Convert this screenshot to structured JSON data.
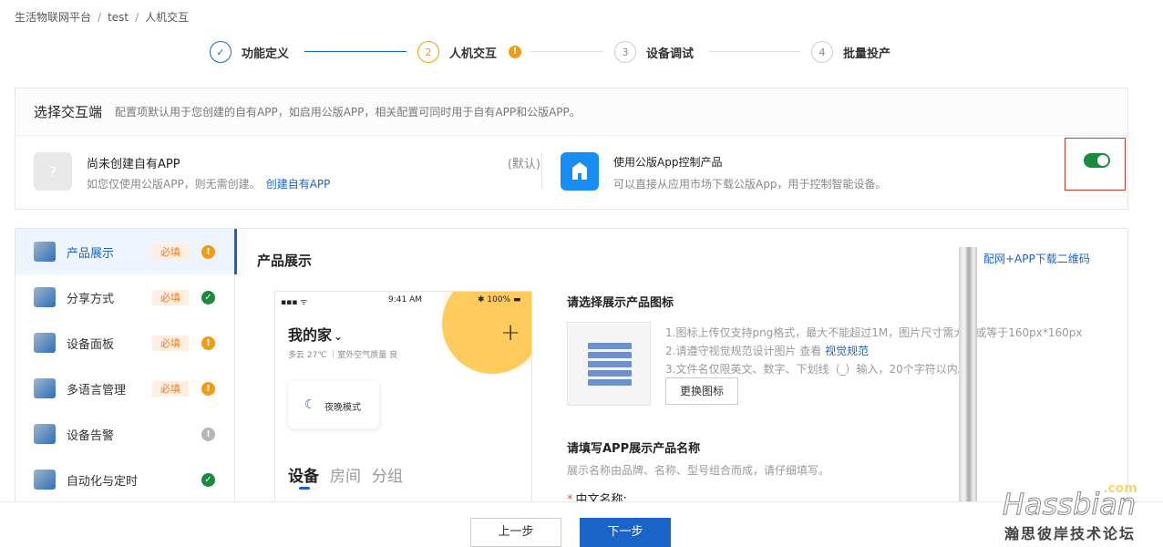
{
  "breadcrumb": [
    "生活物联网平台",
    "test",
    "人机交互"
  ],
  "steps": [
    {
      "num": "✓",
      "label": "功能定义"
    },
    {
      "num": "2",
      "label": "人机交互",
      "warn": "!"
    },
    {
      "num": "3",
      "label": "设备调试"
    },
    {
      "num": "4",
      "label": "批量投产"
    }
  ],
  "interact": {
    "title": "选择交互端",
    "desc": "配置项默认用于您创建的自有APP，如启用公版APP，相关配置可同时用于自有APP和公版APP。",
    "own_app": {
      "icon": "?",
      "name": "尚未创建自有APP",
      "default": "(默认)",
      "desc": "如您仅使用公版APP，则无需创建。",
      "link": "创建自有APP"
    },
    "public_app": {
      "name": "使用公版App控制产品",
      "desc": "可以直接从应用市场下载公版App，用于控制智能设备。",
      "enabled": true
    }
  },
  "sidebar": {
    "items": [
      {
        "label": "产品展示",
        "required": "必填",
        "status": "!",
        "status_color": "orange"
      },
      {
        "label": "分享方式",
        "required": "必填",
        "status": "✓",
        "status_color": "green"
      },
      {
        "label": "设备面板",
        "required": "必填",
        "status": "!",
        "status_color": "orange"
      },
      {
        "label": "多语言管理",
        "required": "必填",
        "status": "!",
        "status_color": "orange"
      },
      {
        "label": "设备告警",
        "required": "",
        "status": "!",
        "status_color": "gray"
      },
      {
        "label": "自动化与定时",
        "required": "",
        "status": "✓",
        "status_color": "green"
      }
    ]
  },
  "content": {
    "title": "产品展示",
    "qr_link": "配网+APP下载二维码",
    "phone": {
      "time": "9:41 AM",
      "battery": "100%",
      "home_title": "我的家",
      "home_caret": "⌄",
      "plus": "+",
      "weather": "多云 27℃ ｜室外空气质量 良",
      "scene_label": "夜晚模式",
      "tabs": [
        "设备",
        "房间",
        "分组"
      ]
    },
    "icon_section": {
      "title": "请选择展示产品图标",
      "hints": [
        "1.图标上传仅支持png格式，最大不能超过1M，图片尺寸需大于或等于160px*160px",
        "2.请遵守视觉规范设计图片 查看 ",
        "3.文件名仅限英文、数字、下划线（_）输入，20个字符以内。"
      ],
      "hint_link": "视觉规范",
      "replace_button": "更换图标"
    },
    "name_section": {
      "title": "请填写APP展示产品名称",
      "desc": "展示名称由品牌、名称、型号组合而成，请仔细填写。",
      "field_label": "中文名称:"
    }
  },
  "footer": {
    "prev": "上一步",
    "next": "下一步"
  },
  "watermark": {
    "com": ".com",
    "brand": "Hassbian",
    "cn": "瀚思彼岸技术论坛"
  },
  "colors": {
    "primary": "#1a64c8",
    "warning": "#f39c12",
    "success": "#1a8a3c"
  }
}
